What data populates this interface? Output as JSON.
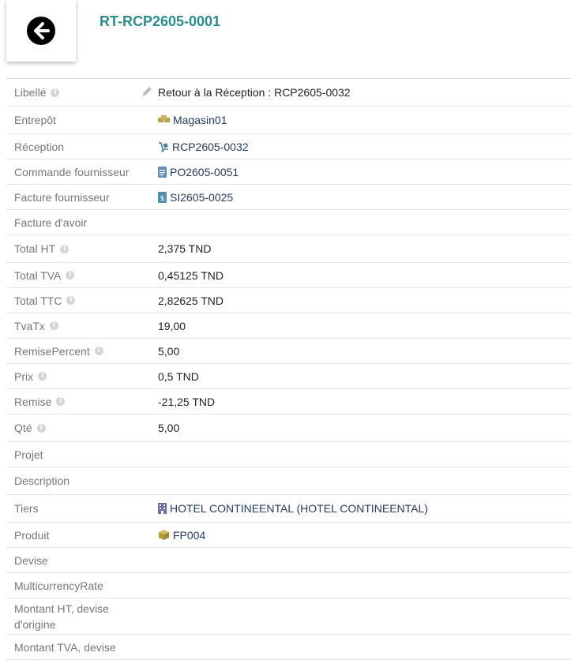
{
  "header": {
    "ref": "RT-RCP2605-0001"
  },
  "fields": {
    "libelle": {
      "label": "Libellé",
      "value": "Retour à la Réception : RCP2605-0032"
    },
    "entrepot": {
      "label": "Entrepôt",
      "value": "Magasin01"
    },
    "reception": {
      "label": "Réception",
      "value": "RCP2605-0032"
    },
    "commande": {
      "label": "Commande fournisseur",
      "value": "PO2605-0051"
    },
    "facture": {
      "label": "Facture fournisseur",
      "value": "SI2605-0025"
    },
    "avoir": {
      "label": "Facture d'avoir",
      "value": ""
    },
    "total_ht": {
      "label": "Total HT",
      "value": "2,375 TND"
    },
    "total_tva": {
      "label": "Total TVA",
      "value": "0,45125 TND"
    },
    "total_ttc": {
      "label": "Total TTC",
      "value": "2,82625 TND"
    },
    "tvatx": {
      "label": "TvaTx",
      "value": "19,00"
    },
    "remise_percent": {
      "label": "RemisePercent",
      "value": "5,00"
    },
    "prix": {
      "label": "Prix",
      "value": "0,5 TND"
    },
    "remise": {
      "label": "Remise",
      "value": "-21,25 TND"
    },
    "qte": {
      "label": "Qté",
      "value": "5,00"
    },
    "projet": {
      "label": "Projet",
      "value": ""
    },
    "description": {
      "label": "Description",
      "value": ""
    },
    "tiers": {
      "label": "Tiers",
      "value": "HOTEL CONTINEENTAL (HOTEL CONTINEENTAL)"
    },
    "produit": {
      "label": "Produit",
      "value": "FP004"
    },
    "devise": {
      "label": "Devise",
      "value": ""
    },
    "multicurrency_rate": {
      "label": "MulticurrencyRate",
      "value": ""
    },
    "montant_ht_devise": {
      "label": "Montant HT, devise d'origine",
      "value": ""
    },
    "montant_tva_devise": {
      "label": "Montant TVA, devise",
      "value": ""
    }
  },
  "colors": {
    "accent": "#2b8d8a",
    "link": "#263c5c",
    "label": "#777777"
  }
}
